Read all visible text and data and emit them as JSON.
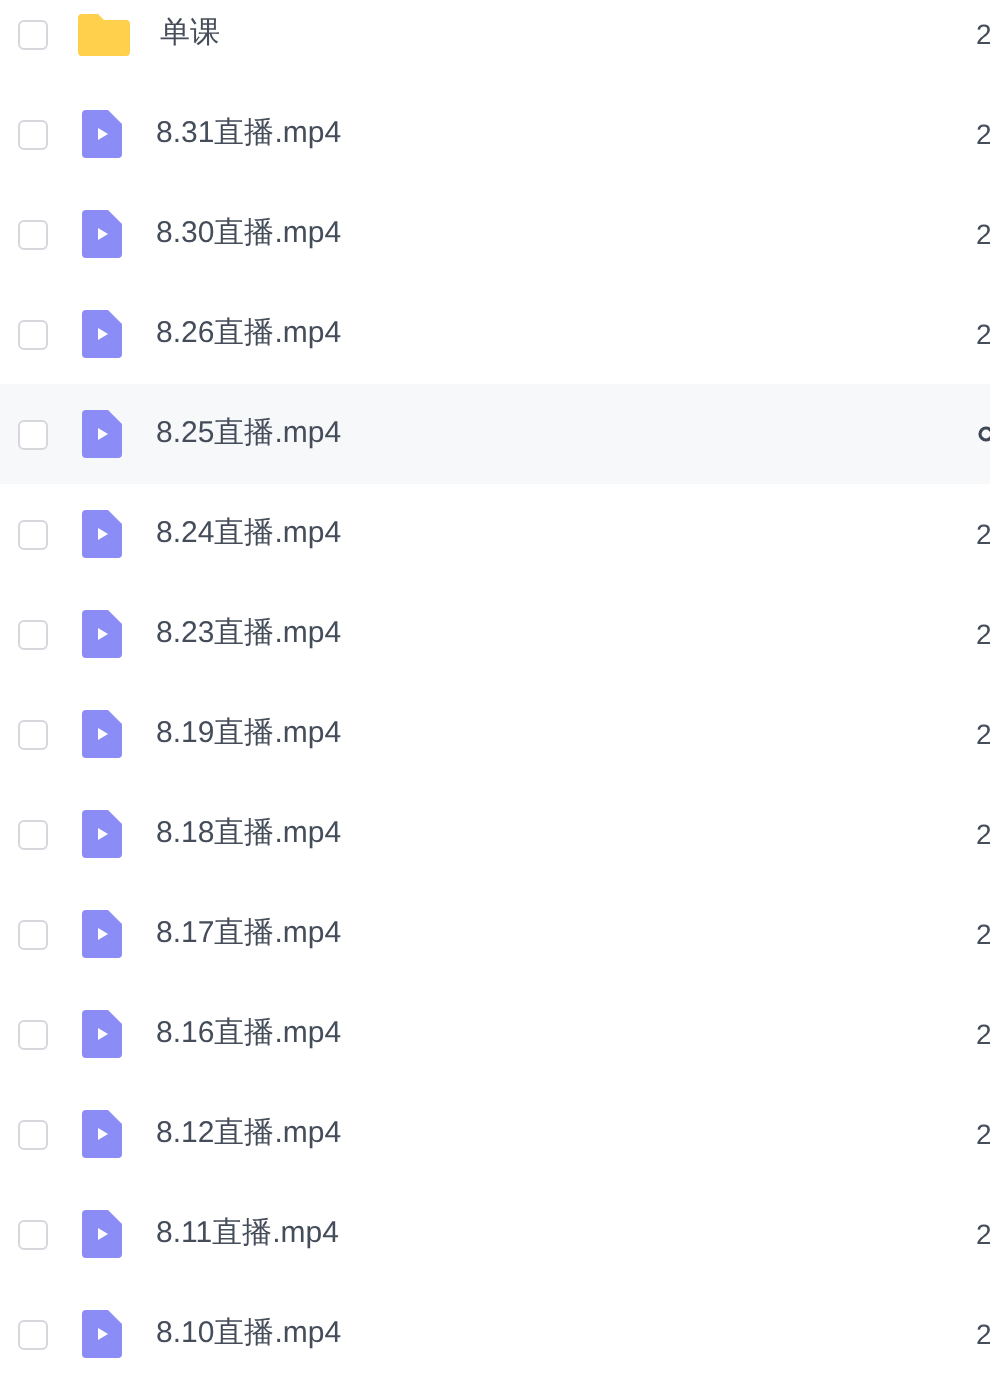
{
  "files": [
    {
      "kind": "folder",
      "name": "单课",
      "checked": false,
      "hovered": false,
      "column_2": "2"
    },
    {
      "kind": "video",
      "name": "8.31直播.mp4",
      "checked": false,
      "hovered": false,
      "column_2": "2"
    },
    {
      "kind": "video",
      "name": "8.30直播.mp4",
      "checked": false,
      "hovered": false,
      "column_2": "2"
    },
    {
      "kind": "video",
      "name": "8.26直播.mp4",
      "checked": false,
      "hovered": false,
      "column_2": "2"
    },
    {
      "kind": "video",
      "name": "8.25直播.mp4",
      "checked": false,
      "hovered": true
    },
    {
      "kind": "video",
      "name": "8.24直播.mp4",
      "checked": false,
      "hovered": false,
      "column_2": "2"
    },
    {
      "kind": "video",
      "name": "8.23直播.mp4",
      "checked": false,
      "hovered": false,
      "column_2": "2"
    },
    {
      "kind": "video",
      "name": "8.19直播.mp4",
      "checked": false,
      "hovered": false,
      "column_2": "2"
    },
    {
      "kind": "video",
      "name": "8.18直播.mp4",
      "checked": false,
      "hovered": false,
      "column_2": "2"
    },
    {
      "kind": "video",
      "name": "8.17直播.mp4",
      "checked": false,
      "hovered": false,
      "column_2": "2"
    },
    {
      "kind": "video",
      "name": "8.16直播.mp4",
      "checked": false,
      "hovered": false,
      "column_2": "2"
    },
    {
      "kind": "video",
      "name": "8.12直播.mp4",
      "checked": false,
      "hovered": false,
      "column_2": "2"
    },
    {
      "kind": "video",
      "name": "8.11直播.mp4",
      "checked": false,
      "hovered": false,
      "column_2": "2"
    },
    {
      "kind": "video",
      "name": "8.10直播.mp4",
      "checked": false,
      "hovered": false,
      "column_2": "2"
    }
  ]
}
